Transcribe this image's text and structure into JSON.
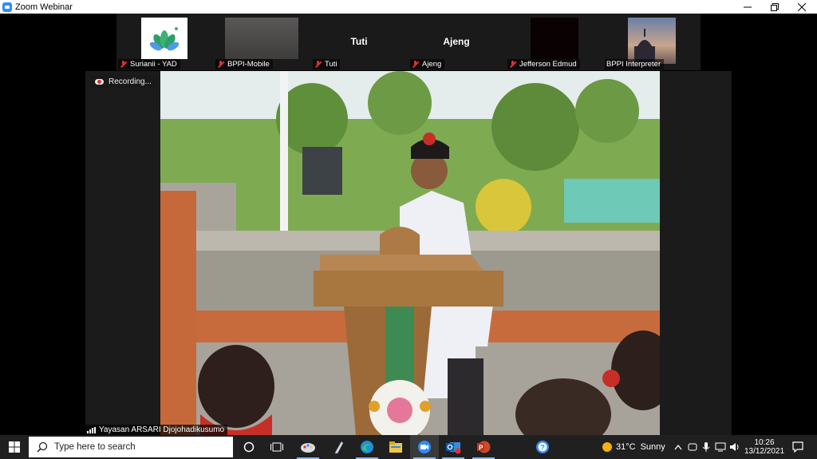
{
  "window": {
    "title": "Zoom Webinar",
    "minimize_icon": "minimize-icon",
    "restore_icon": "restore-icon",
    "close_icon": "close-icon"
  },
  "gallery": {
    "participants": [
      {
        "name": "Surianii - YAD",
        "muted": true,
        "video": "logo"
      },
      {
        "name": "BPPI-Mobile",
        "muted": true,
        "video": "gray"
      },
      {
        "name": "Tuti",
        "muted": true,
        "video": "name",
        "display_name": "Tuti"
      },
      {
        "name": "Ajeng",
        "muted": true,
        "video": "name",
        "display_name": "Ajeng"
      },
      {
        "name": "Jefferson Edmud",
        "muted": true,
        "video": "black"
      },
      {
        "name": "BPPI Interpreter",
        "muted": false,
        "video": "photo"
      }
    ]
  },
  "recording": {
    "label": "Recording..."
  },
  "speaker": {
    "name": "Yayasan ARSARI Djojohadikusumo"
  },
  "taskbar": {
    "search_placeholder": "Type here to search",
    "apps": [
      "task-view",
      "paint",
      "pen",
      "edge",
      "file-explorer",
      "zoom",
      "outlook",
      "powerpoint",
      "help"
    ],
    "weather": {
      "temp": "31°C",
      "condition": "Sunny"
    },
    "time": "10:26",
    "date": "13/12/2021"
  },
  "colors": {
    "accent": "#2d8cff",
    "muted": "#e03131",
    "taskbar": "#202020"
  }
}
